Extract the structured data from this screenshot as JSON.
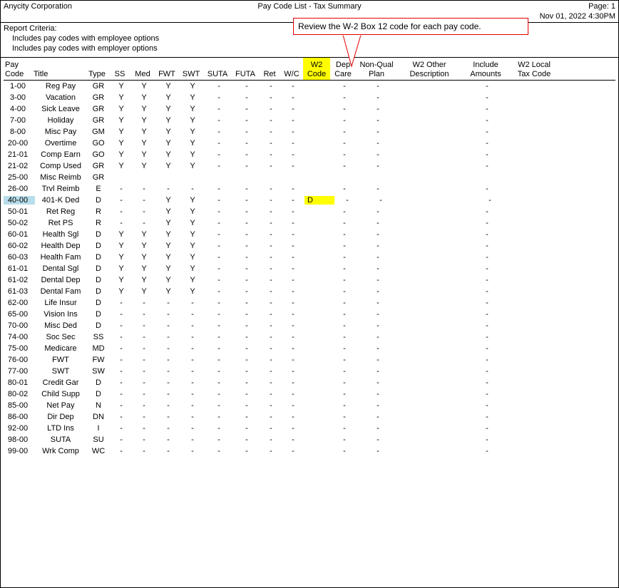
{
  "org": "Anycity Corporation",
  "report_title": "Pay Code List - Tax Summary",
  "page": "Page: 1",
  "timestamp": "Nov 01, 2022 4:30PM",
  "criteria_label": "Report Criteria:",
  "criteria": [
    "Includes pay codes with employee options",
    "Includes pay codes with employer options"
  ],
  "callout": "Review the W-2 Box 12 code for each pay code.",
  "headers": {
    "code": "Pay\nCode",
    "title": "Title",
    "type": "Type",
    "ss": "SS",
    "med": "Med",
    "fwt": "FWT",
    "swt": "SWT",
    "suta": "SUTA",
    "futa": "FUTA",
    "ret": "Ret",
    "wc": "W/C",
    "w2": "W2\nCode",
    "dep": "Dep\nCare",
    "nq": "Non-Qual\nPlan",
    "oth": "W2 Other\nDescription",
    "inc": "Include\nAmounts",
    "loc": "W2 Local\nTax Code"
  },
  "rows": [
    {
      "code": "1-00",
      "title": "Reg Pay",
      "type": "GR",
      "ss": "Y",
      "med": "Y",
      "fwt": "Y",
      "swt": "Y",
      "suta": "-",
      "futa": "-",
      "ret": "-",
      "wc": "-",
      "w2": "",
      "dep": "-",
      "nq": "-",
      "inc": "-",
      "hl": false
    },
    {
      "code": "3-00",
      "title": "Vacation",
      "type": "GR",
      "ss": "Y",
      "med": "Y",
      "fwt": "Y",
      "swt": "Y",
      "suta": "-",
      "futa": "-",
      "ret": "-",
      "wc": "-",
      "w2": "",
      "dep": "-",
      "nq": "-",
      "inc": "-",
      "hl": false
    },
    {
      "code": "4-00",
      "title": "Sick Leave",
      "type": "GR",
      "ss": "Y",
      "med": "Y",
      "fwt": "Y",
      "swt": "Y",
      "suta": "-",
      "futa": "-",
      "ret": "-",
      "wc": "-",
      "w2": "",
      "dep": "-",
      "nq": "-",
      "inc": "-",
      "hl": false
    },
    {
      "code": "7-00",
      "title": "Holiday",
      "type": "GR",
      "ss": "Y",
      "med": "Y",
      "fwt": "Y",
      "swt": "Y",
      "suta": "-",
      "futa": "-",
      "ret": "-",
      "wc": "-",
      "w2": "",
      "dep": "-",
      "nq": "-",
      "inc": "-",
      "hl": false
    },
    {
      "code": "8-00",
      "title": "Misc Pay",
      "type": "GM",
      "ss": "Y",
      "med": "Y",
      "fwt": "Y",
      "swt": "Y",
      "suta": "-",
      "futa": "-",
      "ret": "-",
      "wc": "-",
      "w2": "",
      "dep": "-",
      "nq": "-",
      "inc": "-",
      "hl": false
    },
    {
      "code": "20-00",
      "title": "Overtime",
      "type": "GO",
      "ss": "Y",
      "med": "Y",
      "fwt": "Y",
      "swt": "Y",
      "suta": "-",
      "futa": "-",
      "ret": "-",
      "wc": "-",
      "w2": "",
      "dep": "-",
      "nq": "-",
      "inc": "-",
      "hl": false
    },
    {
      "code": "21-01",
      "title": "Comp Earn",
      "type": "GO",
      "ss": "Y",
      "med": "Y",
      "fwt": "Y",
      "swt": "Y",
      "suta": "-",
      "futa": "-",
      "ret": "-",
      "wc": "-",
      "w2": "",
      "dep": "-",
      "nq": "-",
      "inc": "-",
      "hl": false
    },
    {
      "code": "21-02",
      "title": "Comp Used",
      "type": "GR",
      "ss": "Y",
      "med": "Y",
      "fwt": "Y",
      "swt": "Y",
      "suta": "-",
      "futa": "-",
      "ret": "-",
      "wc": "-",
      "w2": "",
      "dep": "-",
      "nq": "-",
      "inc": "-",
      "hl": false
    },
    {
      "code": "25-00",
      "title": "Misc Reimb",
      "type": "GR",
      "ss": "",
      "med": "",
      "fwt": "",
      "swt": "",
      "suta": "",
      "futa": "",
      "ret": "",
      "wc": "",
      "w2": "",
      "dep": "",
      "nq": "",
      "inc": "",
      "hl": false
    },
    {
      "code": "26-00",
      "title": "Trvl Reimb",
      "type": "E",
      "ss": "-",
      "med": "-",
      "fwt": "-",
      "swt": "-",
      "suta": "-",
      "futa": "-",
      "ret": "-",
      "wc": "-",
      "w2": "",
      "dep": "-",
      "nq": "-",
      "inc": "-",
      "hl": false
    },
    {
      "code": "40-00",
      "title": "401-K Ded",
      "type": "D",
      "ss": "-",
      "med": "-",
      "fwt": "Y",
      "swt": "Y",
      "suta": "-",
      "futa": "-",
      "ret": "-",
      "wc": "-",
      "w2": "D",
      "dep": "-",
      "nq": "-",
      "inc": "-",
      "hl": true
    },
    {
      "code": "50-01",
      "title": "Ret Reg",
      "type": "R",
      "ss": "-",
      "med": "-",
      "fwt": "Y",
      "swt": "Y",
      "suta": "-",
      "futa": "-",
      "ret": "-",
      "wc": "-",
      "w2": "",
      "dep": "-",
      "nq": "-",
      "inc": "-",
      "hl": false
    },
    {
      "code": "50-02",
      "title": "Ret PS",
      "type": "R",
      "ss": "-",
      "med": "-",
      "fwt": "Y",
      "swt": "Y",
      "suta": "-",
      "futa": "-",
      "ret": "-",
      "wc": "-",
      "w2": "",
      "dep": "-",
      "nq": "-",
      "inc": "-",
      "hl": false
    },
    {
      "code": "60-01",
      "title": "Health Sgl",
      "type": "D",
      "ss": "Y",
      "med": "Y",
      "fwt": "Y",
      "swt": "Y",
      "suta": "-",
      "futa": "-",
      "ret": "-",
      "wc": "-",
      "w2": "",
      "dep": "-",
      "nq": "-",
      "inc": "-",
      "hl": false
    },
    {
      "code": "60-02",
      "title": "Health Dep",
      "type": "D",
      "ss": "Y",
      "med": "Y",
      "fwt": "Y",
      "swt": "Y",
      "suta": "-",
      "futa": "-",
      "ret": "-",
      "wc": "-",
      "w2": "",
      "dep": "-",
      "nq": "-",
      "inc": "-",
      "hl": false
    },
    {
      "code": "60-03",
      "title": "Health Fam",
      "type": "D",
      "ss": "Y",
      "med": "Y",
      "fwt": "Y",
      "swt": "Y",
      "suta": "-",
      "futa": "-",
      "ret": "-",
      "wc": "-",
      "w2": "",
      "dep": "-",
      "nq": "-",
      "inc": "-",
      "hl": false
    },
    {
      "code": "61-01",
      "title": "Dental Sgl",
      "type": "D",
      "ss": "Y",
      "med": "Y",
      "fwt": "Y",
      "swt": "Y",
      "suta": "-",
      "futa": "-",
      "ret": "-",
      "wc": "-",
      "w2": "",
      "dep": "-",
      "nq": "-",
      "inc": "-",
      "hl": false
    },
    {
      "code": "61-02",
      "title": "Dental Dep",
      "type": "D",
      "ss": "Y",
      "med": "Y",
      "fwt": "Y",
      "swt": "Y",
      "suta": "-",
      "futa": "-",
      "ret": "-",
      "wc": "-",
      "w2": "",
      "dep": "-",
      "nq": "-",
      "inc": "-",
      "hl": false
    },
    {
      "code": "61-03",
      "title": "Dental Fam",
      "type": "D",
      "ss": "Y",
      "med": "Y",
      "fwt": "Y",
      "swt": "Y",
      "suta": "-",
      "futa": "-",
      "ret": "-",
      "wc": "-",
      "w2": "",
      "dep": "-",
      "nq": "-",
      "inc": "-",
      "hl": false
    },
    {
      "code": "62-00",
      "title": "Life Insur",
      "type": "D",
      "ss": "-",
      "med": "-",
      "fwt": "-",
      "swt": "-",
      "suta": "-",
      "futa": "-",
      "ret": "-",
      "wc": "-",
      "w2": "",
      "dep": "-",
      "nq": "-",
      "inc": "-",
      "hl": false
    },
    {
      "code": "65-00",
      "title": "Vision Ins",
      "type": "D",
      "ss": "-",
      "med": "-",
      "fwt": "-",
      "swt": "-",
      "suta": "-",
      "futa": "-",
      "ret": "-",
      "wc": "-",
      "w2": "",
      "dep": "-",
      "nq": "-",
      "inc": "-",
      "hl": false
    },
    {
      "code": "70-00",
      "title": "Misc Ded",
      "type": "D",
      "ss": "-",
      "med": "-",
      "fwt": "-",
      "swt": "-",
      "suta": "-",
      "futa": "-",
      "ret": "-",
      "wc": "-",
      "w2": "",
      "dep": "-",
      "nq": "-",
      "inc": "-",
      "hl": false
    },
    {
      "code": "74-00",
      "title": "Soc Sec",
      "type": "SS",
      "ss": "-",
      "med": "-",
      "fwt": "-",
      "swt": "-",
      "suta": "-",
      "futa": "-",
      "ret": "-",
      "wc": "-",
      "w2": "",
      "dep": "-",
      "nq": "-",
      "inc": "-",
      "hl": false
    },
    {
      "code": "75-00",
      "title": "Medicare",
      "type": "MD",
      "ss": "-",
      "med": "-",
      "fwt": "-",
      "swt": "-",
      "suta": "-",
      "futa": "-",
      "ret": "-",
      "wc": "-",
      "w2": "",
      "dep": "-",
      "nq": "-",
      "inc": "-",
      "hl": false
    },
    {
      "code": "76-00",
      "title": "FWT",
      "type": "FW",
      "ss": "-",
      "med": "-",
      "fwt": "-",
      "swt": "-",
      "suta": "-",
      "futa": "-",
      "ret": "-",
      "wc": "-",
      "w2": "",
      "dep": "-",
      "nq": "-",
      "inc": "-",
      "hl": false
    },
    {
      "code": "77-00",
      "title": "SWT",
      "type": "SW",
      "ss": "-",
      "med": "-",
      "fwt": "-",
      "swt": "-",
      "suta": "-",
      "futa": "-",
      "ret": "-",
      "wc": "-",
      "w2": "",
      "dep": "-",
      "nq": "-",
      "inc": "-",
      "hl": false
    },
    {
      "code": "80-01",
      "title": "Credit Gar",
      "type": "D",
      "ss": "-",
      "med": "-",
      "fwt": "-",
      "swt": "-",
      "suta": "-",
      "futa": "-",
      "ret": "-",
      "wc": "-",
      "w2": "",
      "dep": "-",
      "nq": "-",
      "inc": "-",
      "hl": false
    },
    {
      "code": "80-02",
      "title": "Child Supp",
      "type": "D",
      "ss": "-",
      "med": "-",
      "fwt": "-",
      "swt": "-",
      "suta": "-",
      "futa": "-",
      "ret": "-",
      "wc": "-",
      "w2": "",
      "dep": "-",
      "nq": "-",
      "inc": "-",
      "hl": false
    },
    {
      "code": "85-00",
      "title": "Net Pay",
      "type": "N",
      "ss": "-",
      "med": "-",
      "fwt": "-",
      "swt": "-",
      "suta": "-",
      "futa": "-",
      "ret": "-",
      "wc": "-",
      "w2": "",
      "dep": "-",
      "nq": "-",
      "inc": "-",
      "hl": false
    },
    {
      "code": "86-00",
      "title": "Dir Dep",
      "type": "DN",
      "ss": "-",
      "med": "-",
      "fwt": "-",
      "swt": "-",
      "suta": "-",
      "futa": "-",
      "ret": "-",
      "wc": "-",
      "w2": "",
      "dep": "-",
      "nq": "-",
      "inc": "-",
      "hl": false
    },
    {
      "code": "92-00",
      "title": "LTD Ins",
      "type": "I",
      "ss": "-",
      "med": "-",
      "fwt": "-",
      "swt": "-",
      "suta": "-",
      "futa": "-",
      "ret": "-",
      "wc": "-",
      "w2": "",
      "dep": "-",
      "nq": "-",
      "inc": "-",
      "hl": false
    },
    {
      "code": "98-00",
      "title": "SUTA",
      "type": "SU",
      "ss": "-",
      "med": "-",
      "fwt": "-",
      "swt": "-",
      "suta": "-",
      "futa": "-",
      "ret": "-",
      "wc": "-",
      "w2": "",
      "dep": "-",
      "nq": "-",
      "inc": "-",
      "hl": false
    },
    {
      "code": "99-00",
      "title": "Wrk Comp",
      "type": "WC",
      "ss": "-",
      "med": "-",
      "fwt": "-",
      "swt": "-",
      "suta": "-",
      "futa": "-",
      "ret": "-",
      "wc": "-",
      "w2": "",
      "dep": "-",
      "nq": "-",
      "inc": "-",
      "hl": false
    }
  ]
}
